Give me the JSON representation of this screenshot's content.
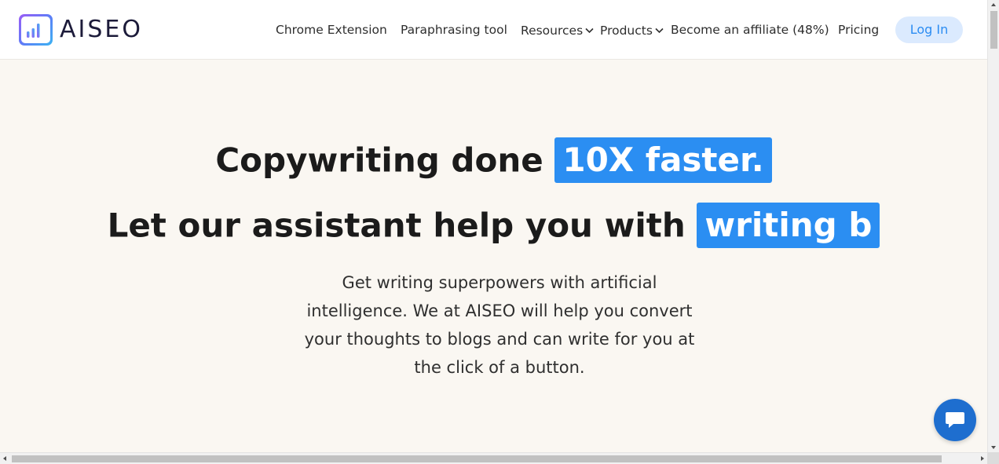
{
  "header": {
    "logo_text": "AISEO",
    "logo_icon": "bar-chart-logo-icon",
    "nav": {
      "chrome_extension": "Chrome Extension",
      "paraphrasing_tool": "Paraphrasing tool",
      "resources": "Resources",
      "products": "Products",
      "affiliate": "Become an affiliate (48%)",
      "pricing": "Pricing"
    },
    "dropdown_icon": "chevron-down-icon",
    "login_label": "Log In"
  },
  "hero": {
    "line1_prefix": "Copywriting done",
    "line1_highlight": "10X faster.",
    "line2_prefix": "Let our assistant help you with",
    "line2_highlight": "writing b",
    "subtext": "Get writing superpowers with artificial intelligence. We at AISEO will help you convert your thoughts to blogs and can write for you at the click of a button."
  },
  "chat_widget": {
    "icon": "chat-bubble-icon"
  },
  "colors": {
    "accent": "#2b8ef2",
    "login_bg": "#dbeafe",
    "page_bg": "#faf7f2",
    "chat_bg": "#1e6ecf"
  }
}
